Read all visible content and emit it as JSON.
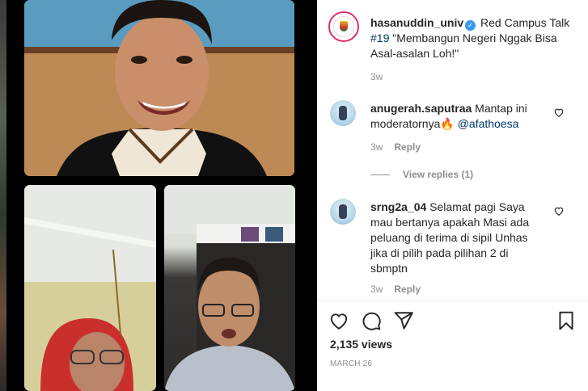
{
  "post": {
    "author": "hasanuddin_univ",
    "caption": "Red Campus Talk",
    "hashtag": "#19",
    "caption_rest": "\"Membangun Negeri Nggak Bisa Asal-asalan Loh!\"",
    "age": "3w"
  },
  "comments": [
    {
      "user": "anugerah.saputraa",
      "text": "Mantap ini moderatornya🔥",
      "mention": "@afathoesa",
      "age": "3w",
      "reply_label": "Reply",
      "view_replies": "View replies (1)"
    },
    {
      "user": "srng2a_04",
      "text": "Selamat pagi Saya mau bertanya apakah Masi ada peluang di terima di sipil Unhas jika di pilih pada pilihan 2 di sbmptn",
      "age": "3w",
      "reply_label": "Reply"
    }
  ],
  "stats": {
    "views": "2,135 views",
    "date": "MARCH 26"
  },
  "icons": {
    "like": "heart-icon",
    "comment": "comment-icon",
    "share": "send-icon",
    "save": "bookmark-icon",
    "comment_like": "heart-outline-icon",
    "verified": "verified-badge-icon"
  },
  "colors": {
    "link": "#00376b",
    "verified": "#3897f0",
    "muted": "#8e8e8e",
    "ring": "#e1306c"
  }
}
